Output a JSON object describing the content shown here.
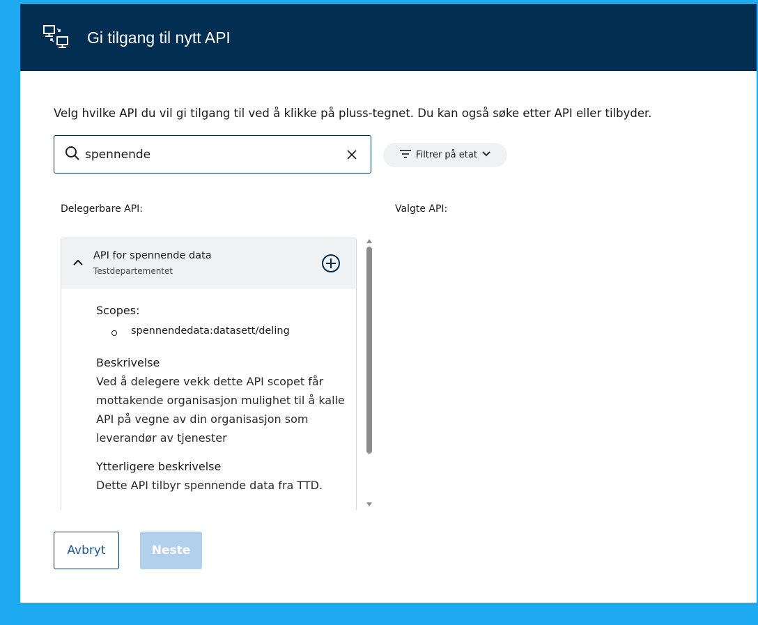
{
  "modal": {
    "title": "Gi tilgang til nytt API",
    "header_icon": "api-delegation-icon",
    "instruction": "Velg hvilke API du vil gi tilgang til ved å klikke på pluss-tegnet. Du kan også søke etter API eller tilbyder."
  },
  "search": {
    "value": "spennende",
    "icon": "search-icon",
    "clear_icon": "close-icon"
  },
  "filter": {
    "label": "Filtrer på etat",
    "icon": "filter-icon"
  },
  "columns": {
    "left_label": "Delegerbare API:",
    "right_label": "Valgte API:"
  },
  "api_item": {
    "title": "API for spennende data",
    "owner": "Testdepartementet",
    "expanded": true,
    "scopes_heading": "Scopes:",
    "scopes": [
      "spennendedata:datasett/deling"
    ],
    "description_heading": "Beskrivelse",
    "description": "Ved å delegere vekk dette API scopet får mottakende organisasjon mulighet til å kalle API på vegne av din organisasjon som leverandør av tjenester",
    "extra_heading": "Ytterligere beskrivelse",
    "extra_description": "Dette API tilbyr spennende data fra TTD."
  },
  "buttons": {
    "cancel": "Avbryt",
    "next": "Neste"
  },
  "colors": {
    "header_bg": "#022f51",
    "page_bg": "#1eaaf1",
    "next_disabled": "#b2d0ec",
    "link_blue": "#1d5a95"
  }
}
